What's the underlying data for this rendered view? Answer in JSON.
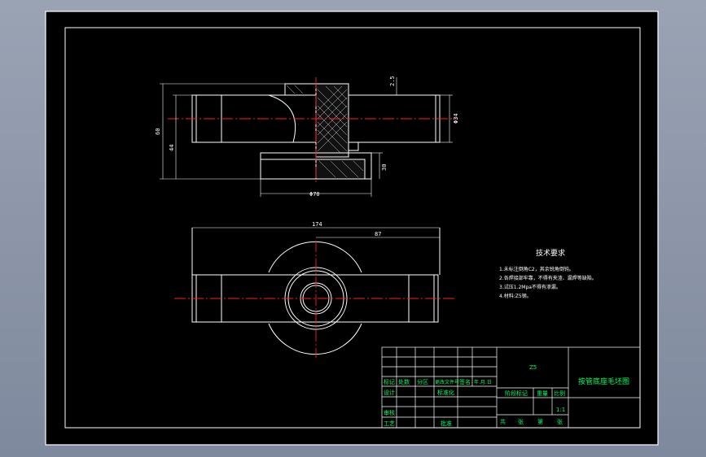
{
  "dimensions": {
    "d_total_height": "60",
    "d_inner_height": "44",
    "d_wall": "2.5",
    "d_right_dia": "Φ34",
    "d_bottom_h": "30",
    "d_bottom_dia": "Φ70",
    "d_total_len": "174",
    "d_half_len": "87"
  },
  "notes": {
    "title": "技术要求",
    "lines": [
      "1.未标注倒角C2，其余锐角倒钝。",
      "2.各焊接部牢靠，不得有夹渣、漏焊等缺陷。",
      "3.试压1.2Mpa不得有渗漏。",
      "4.材料:Z5钢。"
    ]
  },
  "title_block": {
    "material": "Z5",
    "drawing_name": "按管底座毛坯图",
    "scale": "1:1",
    "headers": [
      "标记",
      "处数",
      "分区",
      "更改文件号",
      "签名",
      "年.月.日"
    ],
    "row_design": "设计",
    "row_standard": "标准化",
    "row_review": "审核",
    "row_process": "工艺",
    "row_approve": "批准",
    "stage_label": "阶段标记",
    "weight_label": "重量",
    "scale_label": "比例",
    "sheet_total": "共",
    "sheet_num": "张",
    "sheet_of": "第",
    "sheet_num2": "张"
  },
  "colors": {
    "background": "#000000",
    "frame": "#ffffff",
    "centerline": "#ff2020",
    "text_block": "#00ff66"
  }
}
